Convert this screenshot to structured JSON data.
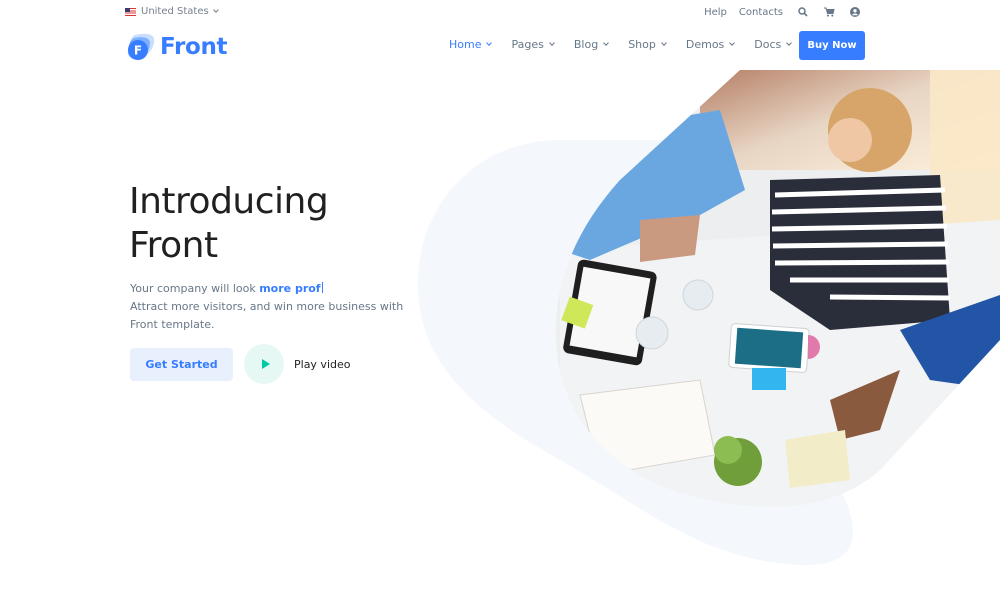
{
  "topbar": {
    "region_label": "United States",
    "links": [
      "Help",
      "Contacts"
    ],
    "icons": [
      "search-icon",
      "cart-icon",
      "user-icon"
    ]
  },
  "brand": {
    "name": "Front",
    "logo_letter": "F",
    "color": "#377dff"
  },
  "nav": {
    "items": [
      {
        "label": "Home",
        "active": true
      },
      {
        "label": "Pages",
        "active": false
      },
      {
        "label": "Blog",
        "active": false
      },
      {
        "label": "Shop",
        "active": false
      },
      {
        "label": "Demos",
        "active": false
      },
      {
        "label": "Docs",
        "active": false
      }
    ],
    "cta_label": "Buy Now"
  },
  "hero": {
    "title_line1": "Introducing",
    "title_line2": "Front",
    "desc_prefix": "Your company will look ",
    "desc_typed": "more prof",
    "desc_line2": "Attract more visitors, and win more business with Front template.",
    "primary_button": "Get Started",
    "video_label": "Play video"
  },
  "colors": {
    "primary": "#377dff",
    "primary_soft": "#e8f0fe",
    "success": "#00c9a7",
    "success_soft": "#e6f8f3",
    "text_muted": "#677788",
    "blob": "#f5f8fd"
  }
}
